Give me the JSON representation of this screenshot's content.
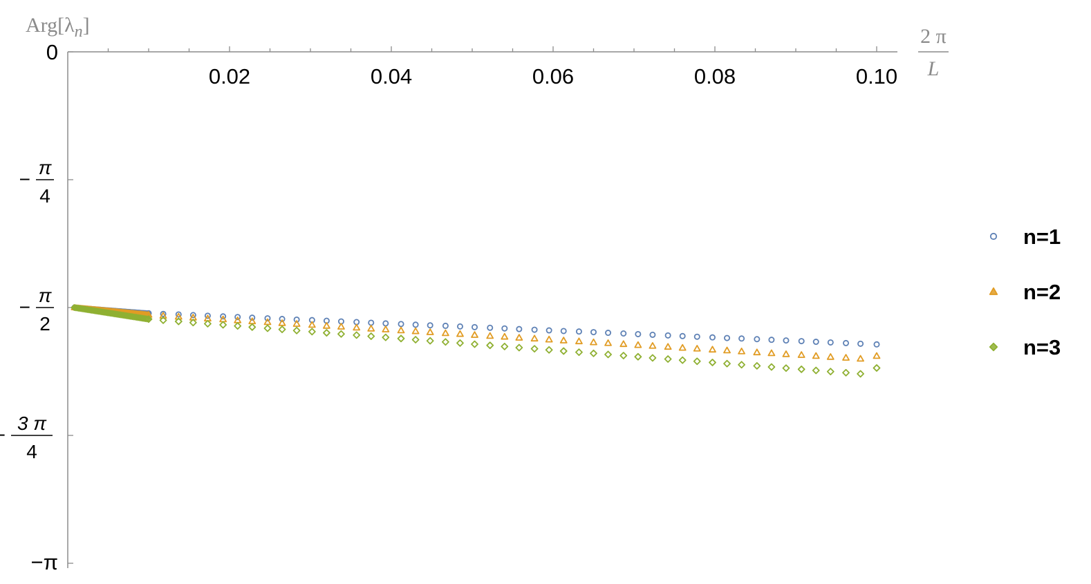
{
  "chart_data": {
    "type": "scatter",
    "xlabel_num": "2 π",
    "xlabel_den": "L",
    "ylabel": "Arg[λ_n]",
    "ylabel_main": "Arg[λ",
    "ylabel_sub": "n",
    "ylabel_close": "]",
    "xlim": [
      0,
      0.1
    ],
    "ylim": [
      -3.14159,
      0
    ],
    "x_ticks": [
      {
        "value": 0.02,
        "label": "0.02"
      },
      {
        "value": 0.04,
        "label": "0.04"
      },
      {
        "value": 0.06,
        "label": "0.06"
      },
      {
        "value": 0.08,
        "label": "0.08"
      },
      {
        "value": 0.1,
        "label": "0.10"
      }
    ],
    "y_ticks": [
      {
        "value": 0,
        "label": "0",
        "sign": "",
        "num": "",
        "den": ""
      },
      {
        "value": -0.7854,
        "label": "-π/4",
        "sign": "−",
        "num": "π",
        "den": "4"
      },
      {
        "value": -1.5708,
        "label": "-π/2",
        "sign": "−",
        "num": "π",
        "den": "2"
      },
      {
        "value": -2.3562,
        "label": "-3π/4",
        "sign": "−",
        "num": "3 π",
        "den": "4"
      },
      {
        "value": -3.14159,
        "label": "-π",
        "sign": "",
        "num": "",
        "den": ""
      }
    ],
    "y_tick_simple": {
      "zero": "0",
      "minus_pi": "−π"
    },
    "legend_position": "right",
    "series": [
      {
        "name": "n=1",
        "marker": "circle",
        "color": "#5E81B5",
        "dense": {
          "x_start": 0.0008,
          "x_end": 0.00995,
          "y_start": -1.5708,
          "y_end": -1.6057,
          "count": 52
        },
        "x": [
          0.01,
          0.0118,
          0.0137,
          0.0155,
          0.0173,
          0.0192,
          0.021,
          0.0228,
          0.0247,
          0.0265,
          0.0283,
          0.0302,
          0.032,
          0.0338,
          0.0357,
          0.0375,
          0.0393,
          0.0412,
          0.043,
          0.0448,
          0.0467,
          0.0485,
          0.0503,
          0.0522,
          0.054,
          0.0558,
          0.0577,
          0.0595,
          0.0613,
          0.0632,
          0.065,
          0.0668,
          0.0687,
          0.0705,
          0.0723,
          0.0742,
          0.076,
          0.0778,
          0.0797,
          0.0815,
          0.0833,
          0.0852,
          0.087,
          0.0888,
          0.0907,
          0.0925,
          0.0943,
          0.0962,
          0.098,
          0.1
        ],
        "y": [
          -1.606,
          -1.61,
          -1.613,
          -1.617,
          -1.621,
          -1.625,
          -1.629,
          -1.633,
          -1.637,
          -1.641,
          -1.645,
          -1.648,
          -1.652,
          -1.656,
          -1.66,
          -1.664,
          -1.668,
          -1.672,
          -1.676,
          -1.68,
          -1.683,
          -1.687,
          -1.691,
          -1.695,
          -1.699,
          -1.703,
          -1.707,
          -1.711,
          -1.715,
          -1.718,
          -1.722,
          -1.726,
          -1.73,
          -1.734,
          -1.738,
          -1.742,
          -1.746,
          -1.75,
          -1.754,
          -1.758,
          -1.761,
          -1.765,
          -1.769,
          -1.773,
          -1.777,
          -1.781,
          -1.785,
          -1.789,
          -1.793,
          -1.797
        ]
      },
      {
        "name": "n=2",
        "marker": "triangle",
        "color": "#E19C24",
        "dense": {
          "x_start": 0.0008,
          "x_end": 0.00995,
          "y_start": -1.5708,
          "y_end": -1.6147,
          "count": 52
        },
        "x": [
          0.01,
          0.0118,
          0.0137,
          0.0155,
          0.0173,
          0.0192,
          0.021,
          0.0228,
          0.0247,
          0.0265,
          0.0283,
          0.0302,
          0.032,
          0.0338,
          0.0357,
          0.0375,
          0.0393,
          0.0412,
          0.043,
          0.0448,
          0.0467,
          0.0485,
          0.0503,
          0.0522,
          0.054,
          0.0558,
          0.0577,
          0.0595,
          0.0613,
          0.0632,
          0.065,
          0.0668,
          0.0687,
          0.0705,
          0.0723,
          0.0742,
          0.076,
          0.0778,
          0.0797,
          0.0815,
          0.0833,
          0.0852,
          0.087,
          0.0888,
          0.0907,
          0.0925,
          0.0943,
          0.0962,
          0.098,
          0.1
        ],
        "y": [
          -1.615,
          -1.621,
          -1.627,
          -1.632,
          -1.638,
          -1.643,
          -1.649,
          -1.655,
          -1.66,
          -1.666,
          -1.671,
          -1.677,
          -1.683,
          -1.688,
          -1.694,
          -1.7,
          -1.705,
          -1.711,
          -1.716,
          -1.722,
          -1.728,
          -1.733,
          -1.739,
          -1.745,
          -1.75,
          -1.756,
          -1.761,
          -1.767,
          -1.773,
          -1.778,
          -1.784,
          -1.789,
          -1.795,
          -1.801,
          -1.806,
          -1.812,
          -1.818,
          -1.823,
          -1.829,
          -1.834,
          -1.84,
          -1.846,
          -1.851,
          -1.857,
          -1.862,
          -1.868,
          -1.874,
          -1.879,
          -1.885,
          -1.868
        ]
      },
      {
        "name": "n=3",
        "marker": "diamond",
        "color": "#8FB032",
        "dense": {
          "x_start": 0.0008,
          "x_end": 0.00995,
          "y_start": -1.5708,
          "y_end": -1.6419,
          "count": 52
        },
        "x": [
          0.01,
          0.0118,
          0.0137,
          0.0155,
          0.0173,
          0.0192,
          0.021,
          0.0228,
          0.0247,
          0.0265,
          0.0283,
          0.0302,
          0.032,
          0.0338,
          0.0357,
          0.0375,
          0.0393,
          0.0412,
          0.043,
          0.0448,
          0.0467,
          0.0485,
          0.0503,
          0.0522,
          0.054,
          0.0558,
          0.0577,
          0.0595,
          0.0613,
          0.0632,
          0.065,
          0.0668,
          0.0687,
          0.0705,
          0.0723,
          0.0742,
          0.076,
          0.0778,
          0.0797,
          0.0815,
          0.0833,
          0.0852,
          0.087,
          0.0888,
          0.0907,
          0.0925,
          0.0943,
          0.0962,
          0.098,
          0.1
        ],
        "y": [
          -1.642,
          -1.649,
          -1.656,
          -1.663,
          -1.67,
          -1.677,
          -1.684,
          -1.691,
          -1.698,
          -1.705,
          -1.712,
          -1.719,
          -1.726,
          -1.733,
          -1.74,
          -1.747,
          -1.754,
          -1.761,
          -1.768,
          -1.775,
          -1.782,
          -1.789,
          -1.796,
          -1.803,
          -1.81,
          -1.817,
          -1.824,
          -1.831,
          -1.838,
          -1.845,
          -1.852,
          -1.859,
          -1.866,
          -1.873,
          -1.88,
          -1.887,
          -1.894,
          -1.901,
          -1.908,
          -1.915,
          -1.922,
          -1.929,
          -1.936,
          -1.943,
          -1.95,
          -1.957,
          -1.964,
          -1.971,
          -1.978,
          -1.942
        ]
      }
    ]
  }
}
